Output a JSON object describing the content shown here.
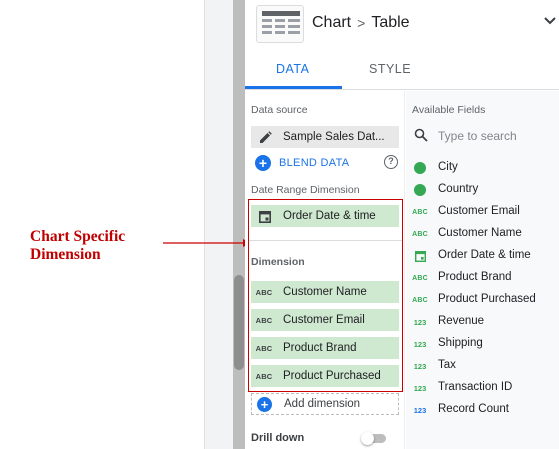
{
  "annotation": {
    "line1": "Chart Specific",
    "line2": "Dimension"
  },
  "header": {
    "chart_label": "Chart",
    "separator": ">",
    "chart_type": "Table"
  },
  "tabs": [
    {
      "label": "DATA"
    },
    {
      "label": "STYLE"
    }
  ],
  "data_source": {
    "section_label": "Data source",
    "name": "Sample Sales Dat...",
    "blend_label": "BLEND DATA"
  },
  "date_range": {
    "section_label": "Date Range Dimension",
    "field": "Order Date & time"
  },
  "dimension": {
    "section_label": "Dimension",
    "items": [
      {
        "label": "Customer Name"
      },
      {
        "label": "Customer Email"
      },
      {
        "label": "Product Brand"
      },
      {
        "label": "Product Purchased"
      }
    ],
    "add_label": "Add dimension"
  },
  "drill_down": {
    "label": "Drill down"
  },
  "available_fields": {
    "section_label": "Available Fields",
    "search_placeholder": "Type to search",
    "items": [
      {
        "label": "City",
        "type": "geo"
      },
      {
        "label": "Country",
        "type": "geo"
      },
      {
        "label": "Customer Email",
        "type": "text"
      },
      {
        "label": "Customer Name",
        "type": "text"
      },
      {
        "label": "Order Date & time",
        "type": "date"
      },
      {
        "label": "Product Brand",
        "type": "text"
      },
      {
        "label": "Product Purchased",
        "type": "text"
      },
      {
        "label": "Revenue",
        "type": "number"
      },
      {
        "label": "Shipping",
        "type": "number"
      },
      {
        "label": "Tax",
        "type": "number"
      },
      {
        "label": "Transaction ID",
        "type": "number"
      },
      {
        "label": "Record Count",
        "type": "number-metric"
      }
    ]
  },
  "icon_text": {
    "abc": "ABC",
    "num": "123"
  },
  "colors": {
    "accent": "#1a73e8",
    "dimension_green": "#34a853",
    "chip_green": "#cfe8d0",
    "annotation_red": "#cc0000"
  }
}
